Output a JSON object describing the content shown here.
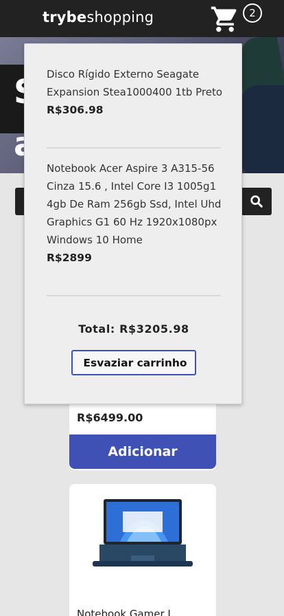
{
  "header": {
    "logo_bold": "trybe",
    "logo_normal": "shopping",
    "cart_count": "2"
  },
  "banner": {
    "text_line1": "S",
    "text_line2": "a"
  },
  "cart": {
    "items": [
      {
        "name": "Disco Rígido Externo Seagate Expansion Stea1000400 1tb Preto",
        "price": "R$306.98"
      },
      {
        "name": "Notebook Acer Aspire 3 A315-56 Cinza 15.6 , Intel Core I3 1005g1 4gb De Ram 256gb Ssd, Intel Uhd Graphics G1 60 Hz 1920x1080px Windows 10 Home",
        "price": "R$2899"
      }
    ],
    "total": "Total: R$3205.98",
    "empty_label": "Esvaziar carrinho"
  },
  "products": [
    {
      "price": "R$6499.00",
      "add_label": "Adicionar"
    },
    {
      "title": "Notebook Gamer L"
    }
  ],
  "colors": {
    "accent": "#3f51b5",
    "header_bg": "#222222",
    "page_bg": "#e6e6e6"
  }
}
